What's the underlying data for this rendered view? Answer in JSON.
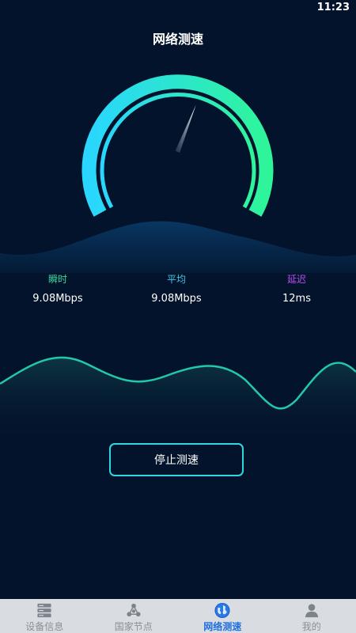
{
  "status_bar": {
    "time": "11:23"
  },
  "header": {
    "title": "网络测速"
  },
  "gauge": {
    "needle_fraction": 0.58
  },
  "stats": [
    {
      "label": "瞬时",
      "value": "9.08Mbps",
      "color": "#39d9a0"
    },
    {
      "label": "平均",
      "value": "9.08Mbps",
      "color": "#3ec8e6"
    },
    {
      "label": "延迟",
      "value": "12ms",
      "color": "#b84cf0"
    }
  ],
  "stop_button": {
    "label": "停止测速"
  },
  "tabs": [
    {
      "label": "设备信息",
      "icon": "server-icon"
    },
    {
      "label": "国家节点",
      "icon": "nodes-icon"
    },
    {
      "label": "网络测速",
      "icon": "globe-icon",
      "active": true
    },
    {
      "label": "我的",
      "icon": "user-icon"
    }
  ],
  "colors": {
    "background": "#03132b",
    "accent_cyan": "#2fd8e0",
    "accent_green": "#2ee89a",
    "tab_active": "#1f6fe0"
  }
}
